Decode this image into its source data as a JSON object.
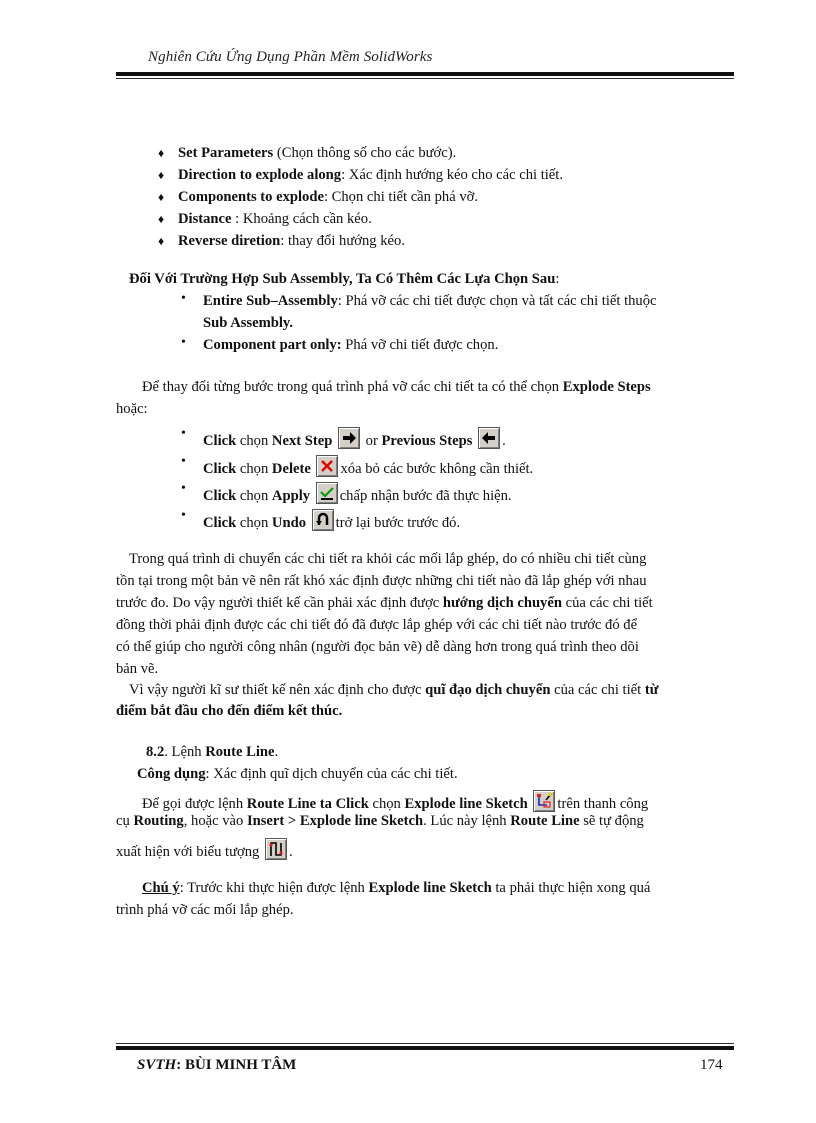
{
  "header": {
    "title": "Nghiên Cứu Ứng Dụng Phần Mềm SolidWorks"
  },
  "options_list": [
    {
      "term": "Set Parameters",
      "text": " (Chọn thông số cho các bước)."
    },
    {
      "term": "Direction to explode along",
      "text": ": Xác định hướng kéo cho các chi tiết."
    },
    {
      "term": "Components to explode",
      "text": ":  Chọn chi tiết cần phá vỡ."
    },
    {
      "term": "Distance",
      "text": " : Khoảng cách cần kéo."
    },
    {
      "term": "Reverse diretion",
      "text": ": thay đổi hướng kéo."
    }
  ],
  "sub_assembly": {
    "heading": "Đối Với Trường Hợp Sub Assembly, Ta Có Thêm Các Lựa Chọn Sau",
    "heading_suffix": ":",
    "items": [
      {
        "term": "Entire Sub–Assembly",
        "text": ": Phá vỡ các chi tiết được chọn và tất các chi tiết thuộc",
        "cont": "Sub Assembly."
      },
      {
        "term": "Component part only:",
        "text": " Phá vỡ chi tiết được chọn."
      }
    ]
  },
  "explode_steps": {
    "intro_1": "Để thay đổi từng bước trong quá trình phá vỡ các chi tiết ta có thể chọn ",
    "intro_bold": "Explode Steps",
    "intro_2": "hoặc:",
    "click_word": "Click",
    "chon_word": " chọn ",
    "items": [
      {
        "command": "Next Step",
        "icon": "arrow-right-icon",
        "mid": " or ",
        "command2": "Previous Steps",
        "icon2": "arrow-left-icon",
        "tail": "."
      },
      {
        "command": "Delete",
        "icon": "delete-x-icon",
        "tail": "xóa bỏ các bước không cần thiết."
      },
      {
        "command": "Apply",
        "icon": "apply-check-icon",
        "tail": "chấp nhận bước đã thực hiện."
      },
      {
        "command": "Undo",
        "icon": "undo-icon",
        "tail": "trở lại bước trước đó."
      }
    ]
  },
  "paragraph_1": {
    "l1": "Trong quá trình di chuyển các chi tiết ra khỏi các mối lắp ghép, do có nhiều chi tiết cùng",
    "l2": "tồn tại trong một bản vẽ nên rất khó xác định được những chi tiết nào đã lắp ghép với nhau",
    "l3a": "trước đo. Do vậy người thiết kế cần phải xác định được ",
    "l3b": "hướng dịch chuyển",
    "l3c": " của các chi tiết",
    "l4": "đồng thời phải định được các chi tiết đó đã được lắp ghép với các chi tiết nào trước đó để",
    "l5": "có thể giúp cho người công nhân (người đọc bản vẽ) dễ dàng hơn trong quá trình theo dõi",
    "l6": "bản vẽ."
  },
  "paragraph_2": {
    "l1a": "Vì vậy người kĩ sư thiết kế nên xác định cho được ",
    "l1b": "quĩ đạo dịch chuyển",
    "l1c": " của các chi tiết ",
    "l1d": "từ",
    "l2": "điểm bắt đầu cho đến điểm kết thúc."
  },
  "section_8_2": {
    "number": "8.2",
    "title_prefix": ". Lệnh ",
    "title_bold": "Route Line",
    "title_suffix": ".",
    "usage_label": "Công dụng",
    "usage_text": ": Xác định quĩ dịch chuyển của các chi tiết.",
    "call_1": "Để gọi được lệnh ",
    "call_1b": "Route Line ta Click",
    "call_1c": " chọn ",
    "call_1d": "Explode line Sketch",
    "call_1e": "trên thanh công",
    "call_2a": "cụ ",
    "call_2b": "Routing",
    "call_2c": ", hoặc vào ",
    "call_2d": "Insert > Explode line Sketch",
    "call_2e": ". Lúc này lệnh ",
    "call_2f": "Route Line",
    "call_2g": " sẽ tự động",
    "call_3": "xuất hiện với biểu tượng ",
    "call_3_tail": ".",
    "icon_sketch": "explode-line-sketch-icon",
    "icon_route": "route-line-icon"
  },
  "note": {
    "label": "Chú ý",
    "text_1": ": Trước khi thực hiện được lệnh ",
    "bold": "Explode line Sketch",
    "text_2": " ta phải thực hiện xong quá",
    "text_3": "trình phá vỡ các mối lắp ghép."
  },
  "footer": {
    "label": "SVTH",
    "colon": ":  ",
    "name": "BÙI MINH TÂM",
    "page_number": "174"
  },
  "bullets": {
    "diamond": "♦",
    "dot": "•"
  }
}
